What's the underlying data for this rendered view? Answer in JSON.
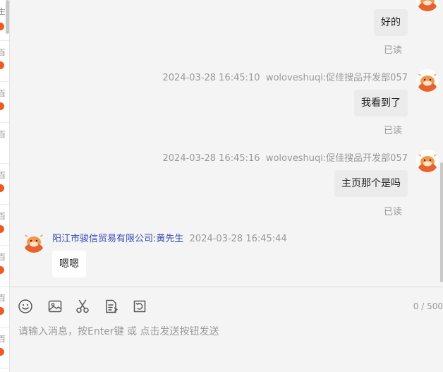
{
  "conversation_list": {
    "items": [
      {
        "fragment": "生"
      },
      {
        "fragment": "百"
      },
      {
        "fragment": "百"
      },
      {
        "fragment": "百"
      },
      {
        "fragment": "百"
      },
      {
        "fragment": "百"
      },
      {
        "fragment": "百"
      },
      {
        "fragment": "百"
      },
      {
        "fragment": "百"
      }
    ]
  },
  "messages": [
    {
      "direction": "out",
      "text": "好的",
      "read_status": "已读"
    },
    {
      "direction": "out",
      "timestamp": "2024-03-28 16:45:10",
      "sender": "woloveshuqi:促佳搜品开发部057",
      "text": "我看到了",
      "read_status": "已读"
    },
    {
      "direction": "out",
      "timestamp": "2024-03-28 16:45:16",
      "sender": "woloveshuqi:促佳搜品开发部057",
      "text": "主页那个是吗",
      "read_status": "已读"
    },
    {
      "direction": "in",
      "sender": "阳江市骏信贸易有限公司:黄先生",
      "timestamp": "2024-03-28 16:45:44",
      "text": "嗯嗯"
    }
  ],
  "toolbar": {
    "icons": [
      "emoji-icon",
      "image-icon",
      "scissors-icon",
      "document-icon",
      "rotate-icon"
    ],
    "counter": "0 / 500"
  },
  "input": {
    "value": "",
    "placeholder": "请输入消息，按Enter键 或 点击发送按钮发送"
  },
  "colors": {
    "accent_orange": "#f05a22",
    "sender_name": "#3b4bb5",
    "bubble_out": "#ebebeb",
    "bubble_in": "#ffffff",
    "background": "#f4f4f4"
  }
}
